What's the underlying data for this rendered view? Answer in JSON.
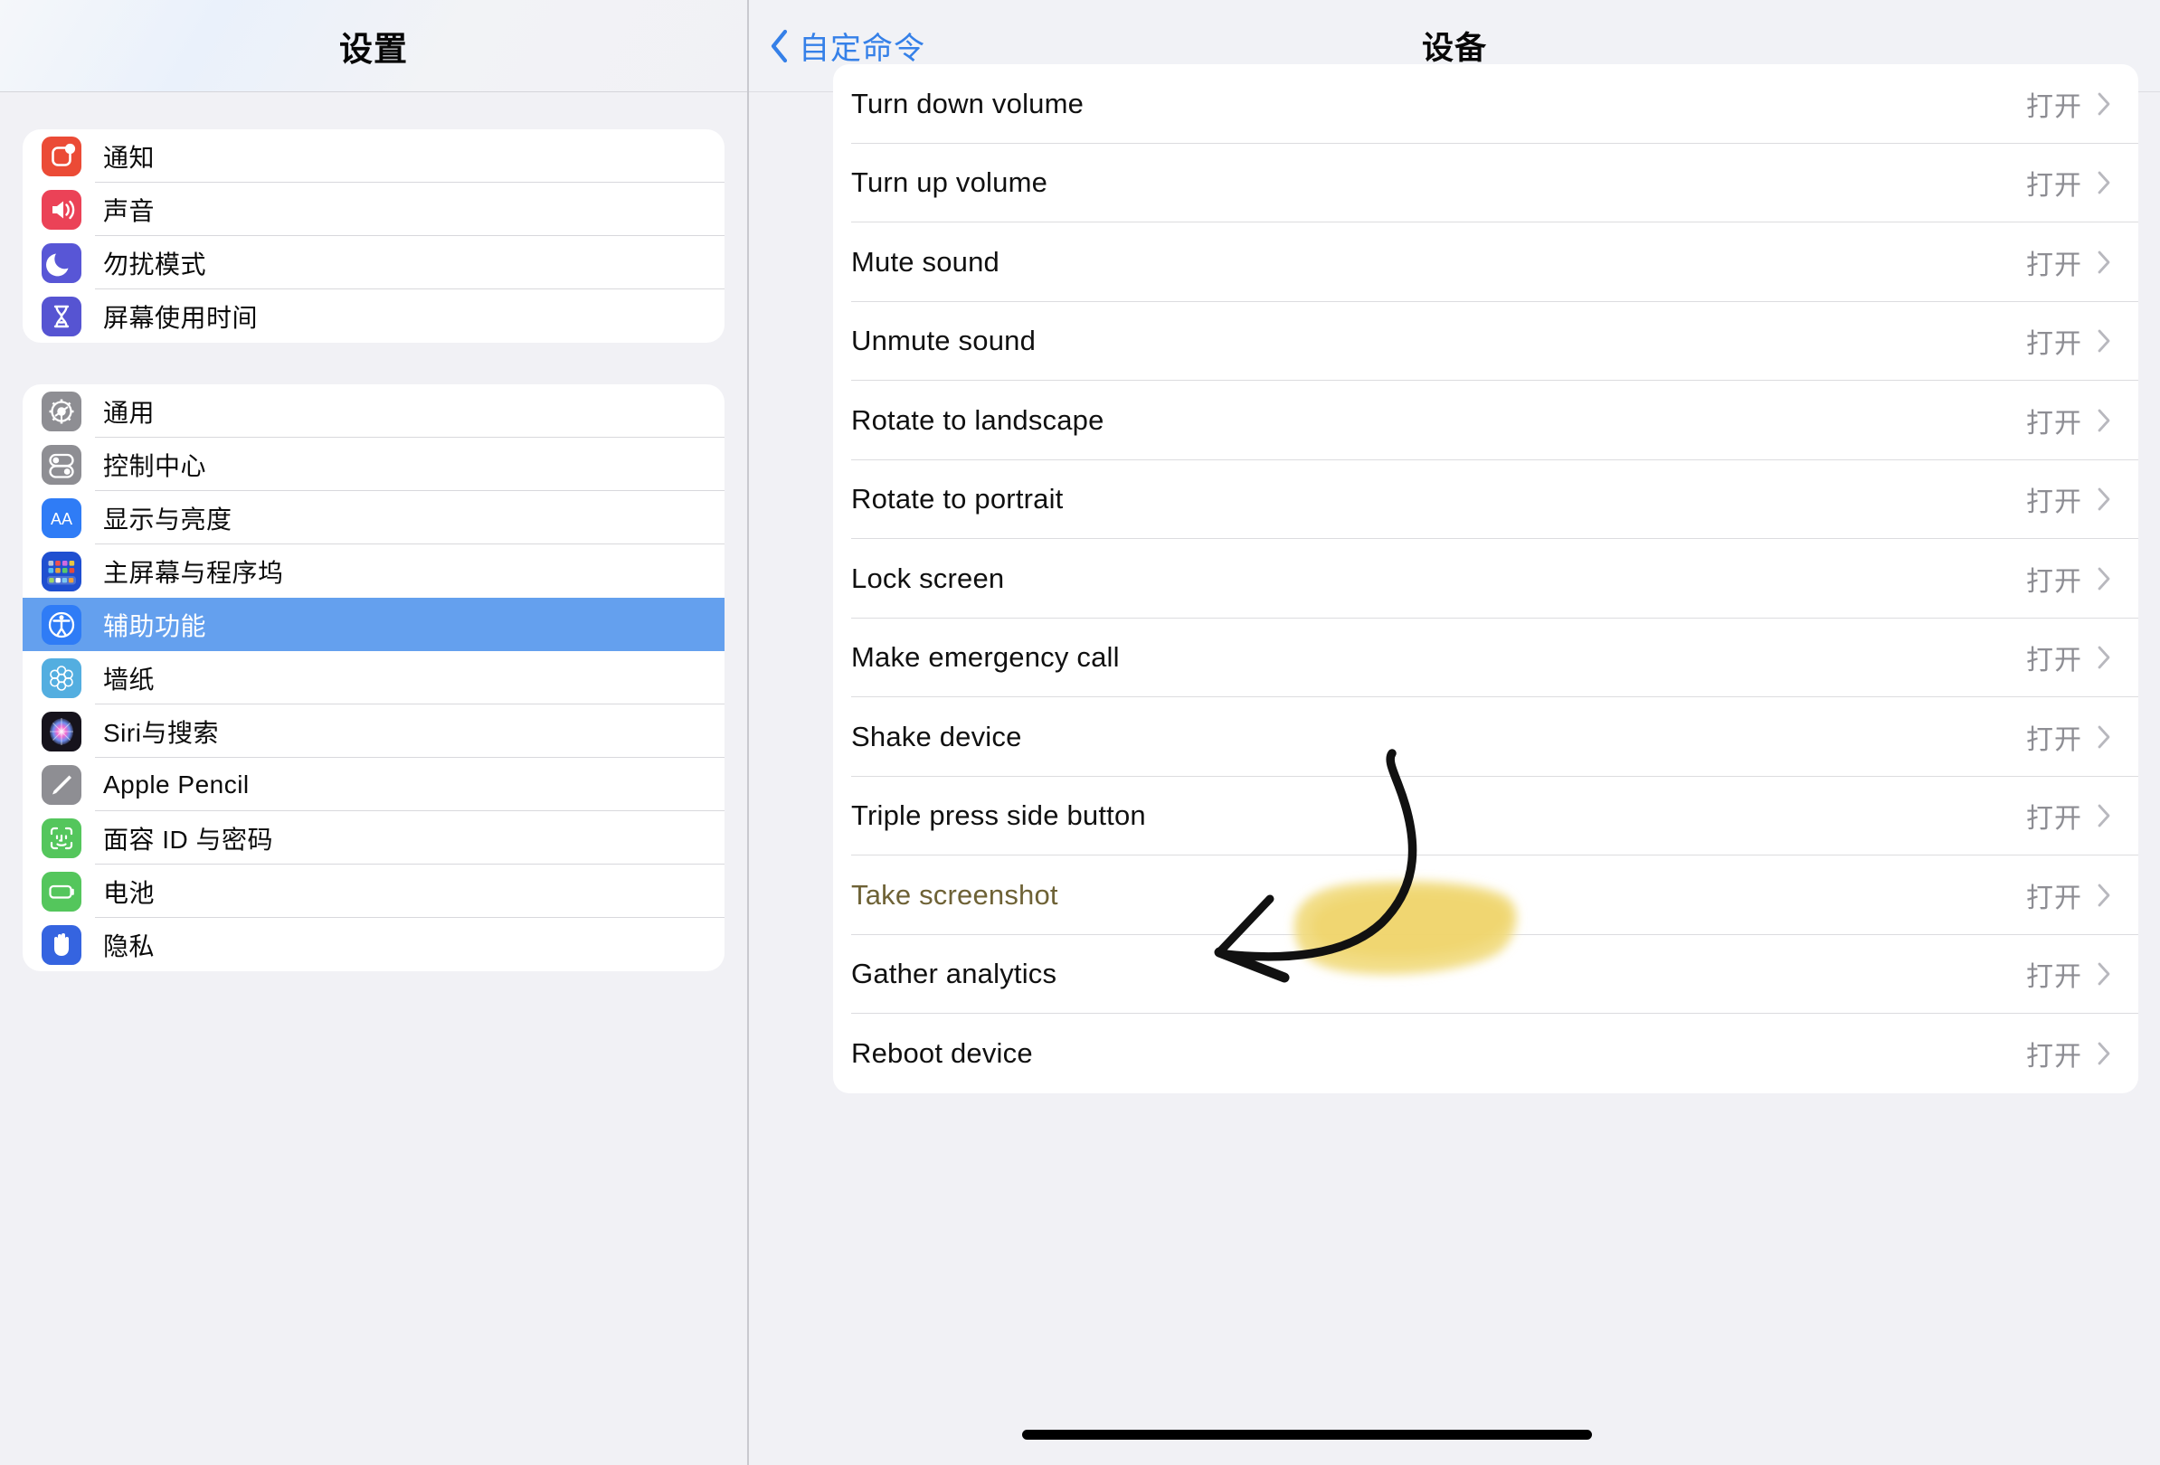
{
  "sidebar": {
    "title": "设置",
    "groups": [
      {
        "items": [
          {
            "label": "通知",
            "icon": "notifications-icon"
          },
          {
            "label": "声音",
            "icon": "sound-icon"
          },
          {
            "label": "勿扰模式",
            "icon": "do-not-disturb-icon"
          },
          {
            "label": "屏幕使用时间",
            "icon": "screen-time-icon"
          }
        ]
      },
      {
        "items": [
          {
            "label": "通用",
            "icon": "general-gear-icon"
          },
          {
            "label": "控制中心",
            "icon": "control-center-icon"
          },
          {
            "label": "显示与亮度",
            "icon": "display-brightness-icon"
          },
          {
            "label": "主屏幕与程序坞",
            "icon": "home-screen-dock-icon"
          },
          {
            "label": "辅助功能",
            "icon": "accessibility-icon",
            "selected": true
          },
          {
            "label": "墙纸",
            "icon": "wallpaper-icon"
          },
          {
            "label": "Siri与搜索",
            "icon": "siri-search-icon"
          },
          {
            "label": "Apple Pencil",
            "icon": "apple-pencil-icon"
          },
          {
            "label": "面容 ID 与密码",
            "icon": "face-id-passcode-icon"
          },
          {
            "label": "电池",
            "icon": "battery-icon"
          },
          {
            "label": "隐私",
            "icon": "privacy-hand-icon"
          }
        ]
      }
    ]
  },
  "detail": {
    "back_label": "自定命令",
    "title": "设备",
    "value_label": "打开",
    "commands": [
      {
        "name": "Turn down volume",
        "value": "打开"
      },
      {
        "name": "Turn up volume",
        "value": "打开"
      },
      {
        "name": "Mute sound",
        "value": "打开"
      },
      {
        "name": "Unmute sound",
        "value": "打开"
      },
      {
        "name": "Rotate to landscape",
        "value": "打开"
      },
      {
        "name": "Rotate to portrait",
        "value": "打开"
      },
      {
        "name": "Lock screen",
        "value": "打开"
      },
      {
        "name": "Make emergency call",
        "value": "打开"
      },
      {
        "name": "Shake device",
        "value": "打开"
      },
      {
        "name": "Triple press side button",
        "value": "打开"
      },
      {
        "name": "Take screenshot",
        "value": "打开",
        "highlighted": true
      },
      {
        "name": "Gather analytics",
        "value": "打开"
      },
      {
        "name": "Reboot device",
        "value": "打开"
      }
    ]
  },
  "annotations": {
    "highlighter_color": "#f2dd83",
    "arrow_color": "#111111",
    "target_row": "Take screenshot"
  },
  "colors": {
    "accent_blue": "#3580e8",
    "selected_row": "#64a0ee",
    "panel_bg": "#f1f1f5",
    "card_bg": "#ffffff",
    "secondary_text": "#8d8d93"
  }
}
